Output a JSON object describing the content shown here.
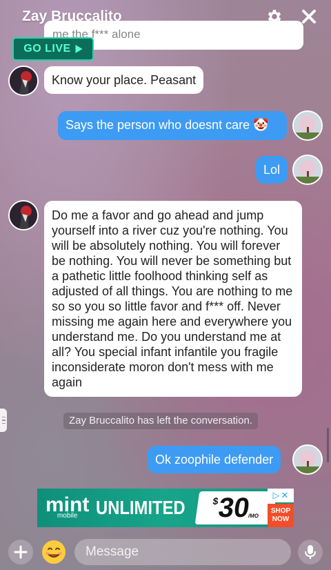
{
  "header": {
    "title": "Zay Bruccalito",
    "settings_icon": "gear-icon",
    "close_icon": "close-icon"
  },
  "go_live": {
    "label": "GO LIVE",
    "icon": "play-triangle-icon"
  },
  "truncated_message": "me the f*** alone",
  "messages": [
    {
      "from": "them",
      "text": "Know your place. Peasant"
    },
    {
      "from": "me",
      "text": "Says the person who doesnt care",
      "emoji": "🤡"
    },
    {
      "from": "me",
      "text": "Lol"
    },
    {
      "from": "them",
      "text": "Do me a favor and go ahead and jump yourself into a river cuz you're nothing. You will be absolutely nothing. You will forever be nothing. You will never be something but a pathetic little foolhood thinking self as adjusted of all things. You are nothing to me so so you so little favor and f*** off. Never missing me again here and everywhere you understand me. Do you understand me at all? You special infant infantile you fragile inconsiderate moron don't mess with me again"
    },
    {
      "from": "me",
      "text": "Ok zoophile defender"
    }
  ],
  "system_notice": "Zay Bruccalito has left the conversation.",
  "ad": {
    "brand": "mint",
    "brand_sub": "mobile",
    "tagline": "UNLIMITED",
    "price_symbol": "$",
    "price": "30",
    "price_unit": "/MO",
    "cta": "SHOP NOW",
    "colors": {
      "bg": "#14957e",
      "cta": "#f24e2a"
    }
  },
  "composer": {
    "placeholder": "Message",
    "add_icon": "plus-icon",
    "sticker_icon": "emoji-icon",
    "mic_icon": "microphone-icon"
  },
  "colors": {
    "my_bubble": "#3d9bf3",
    "their_bubble": "#ffffff",
    "go_live_border": "#20d6a7"
  }
}
